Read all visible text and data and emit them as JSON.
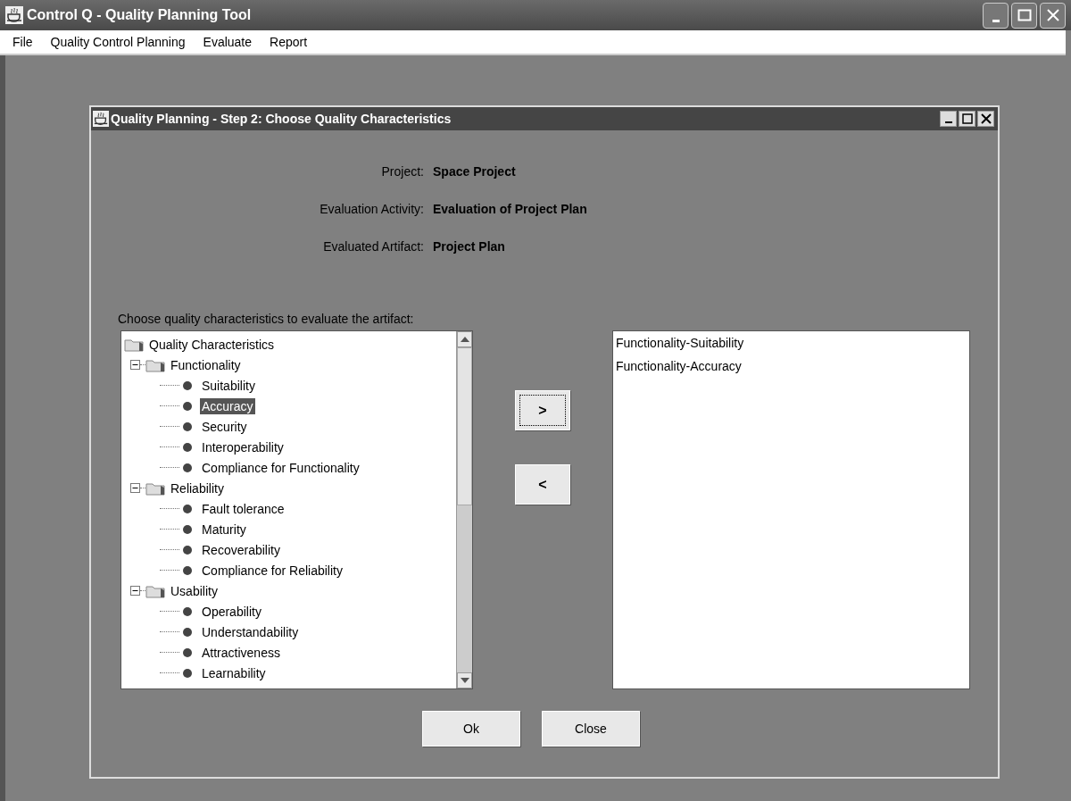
{
  "window": {
    "title": "Control Q - Quality Planning Tool"
  },
  "menu": [
    "File",
    "Quality Control Planning",
    "Evaluate",
    "Report"
  ],
  "dialog": {
    "title": "Quality Planning - Step 2: Choose Quality Characteristics",
    "info": [
      {
        "label": "Project:",
        "value": "Space Project"
      },
      {
        "label": "Evaluation Activity:",
        "value": "Evaluation of Project Plan"
      },
      {
        "label": "Evaluated Artifact:",
        "value": "Project Plan"
      }
    ],
    "prompt": "Choose quality characteristics to evaluate the artifact:",
    "tree": {
      "label": "Quality Characteristics",
      "children": [
        {
          "label": "Functionality",
          "expanded": true,
          "children": [
            {
              "label": "Suitability",
              "selected": false
            },
            {
              "label": "Accuracy",
              "selected": true
            },
            {
              "label": "Security",
              "selected": false
            },
            {
              "label": "Interoperability",
              "selected": false
            },
            {
              "label": "Compliance for Functionality",
              "selected": false
            }
          ]
        },
        {
          "label": "Reliability",
          "expanded": true,
          "children": [
            {
              "label": "Fault tolerance",
              "selected": false
            },
            {
              "label": "Maturity",
              "selected": false
            },
            {
              "label": "Recoverability",
              "selected": false
            },
            {
              "label": "Compliance for Reliability",
              "selected": false
            }
          ]
        },
        {
          "label": "Usability",
          "expanded": true,
          "children": [
            {
              "label": "Operability",
              "selected": false
            },
            {
              "label": "Understandability",
              "selected": false
            },
            {
              "label": "Attractiveness",
              "selected": false
            },
            {
              "label": "Learnability",
              "selected": false
            }
          ]
        }
      ]
    },
    "move_buttons": [
      {
        "label": ">",
        "focused": true
      },
      {
        "label": "<",
        "focused": false
      }
    ],
    "chosen": [
      "Functionality-Suitability",
      "Functionality-Accuracy"
    ],
    "buttons": [
      "Ok",
      "Close"
    ]
  }
}
